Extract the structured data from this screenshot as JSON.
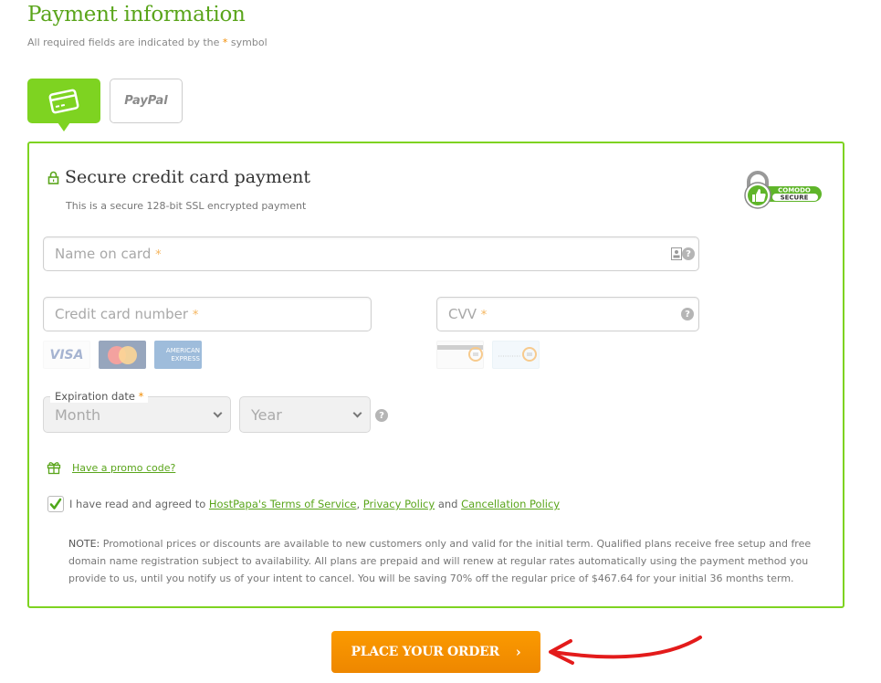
{
  "header": {
    "title": "Payment information",
    "required_note_prefix": "All required fields are indicated by the ",
    "required_symbol": "*",
    "required_note_suffix": " symbol"
  },
  "payment_methods": {
    "card_icon": "credit-card-icon",
    "paypal_label": "PayPal",
    "selected": "card"
  },
  "panel": {
    "title": "Secure credit card payment",
    "subtitle": "This is a secure 128-bit SSL encrypted payment",
    "badge_line1": "COMODO",
    "badge_line2": "SECURE"
  },
  "form": {
    "name_placeholder": "Name on card",
    "card_number_placeholder": "Credit card number",
    "cvv_placeholder": "CVV",
    "required_symbol": "*",
    "help_symbol": "?",
    "card_brands": [
      "VISA",
      "MasterCard",
      "AMERICAN EXPRESS"
    ],
    "expiration_label": "Expiration date",
    "month_value": "Month",
    "year_value": "Year"
  },
  "promo": {
    "label": "Have a promo code?"
  },
  "agreement": {
    "checked": true,
    "prefix": "I have read and agreed to ",
    "terms_link": "HostPapa's Terms of Service",
    "comma": ",",
    "privacy_link": "Privacy Policy",
    "and": " and ",
    "cancellation_link": "Cancellation Policy"
  },
  "note": {
    "label": "NOTE:",
    "text": " Promotional prices or discounts are available to new customers only and valid for the initial term. Qualified plans receive free setup and free domain name registration subject to availability. All plans are prepaid and will renew at regular rates automatically using the payment method you provide to us, until you notify us of your intent to cancel. You will be saving 70% off the regular price of $467.64 for your initial 36 months term."
  },
  "order_button": {
    "label": "PLACE YOUR ORDER",
    "arrow": "›"
  },
  "colors": {
    "brand_green": "#7ed321",
    "link_green": "#5aa51b",
    "orange": "#f28c00",
    "annotation_red": "#e31b1b"
  }
}
